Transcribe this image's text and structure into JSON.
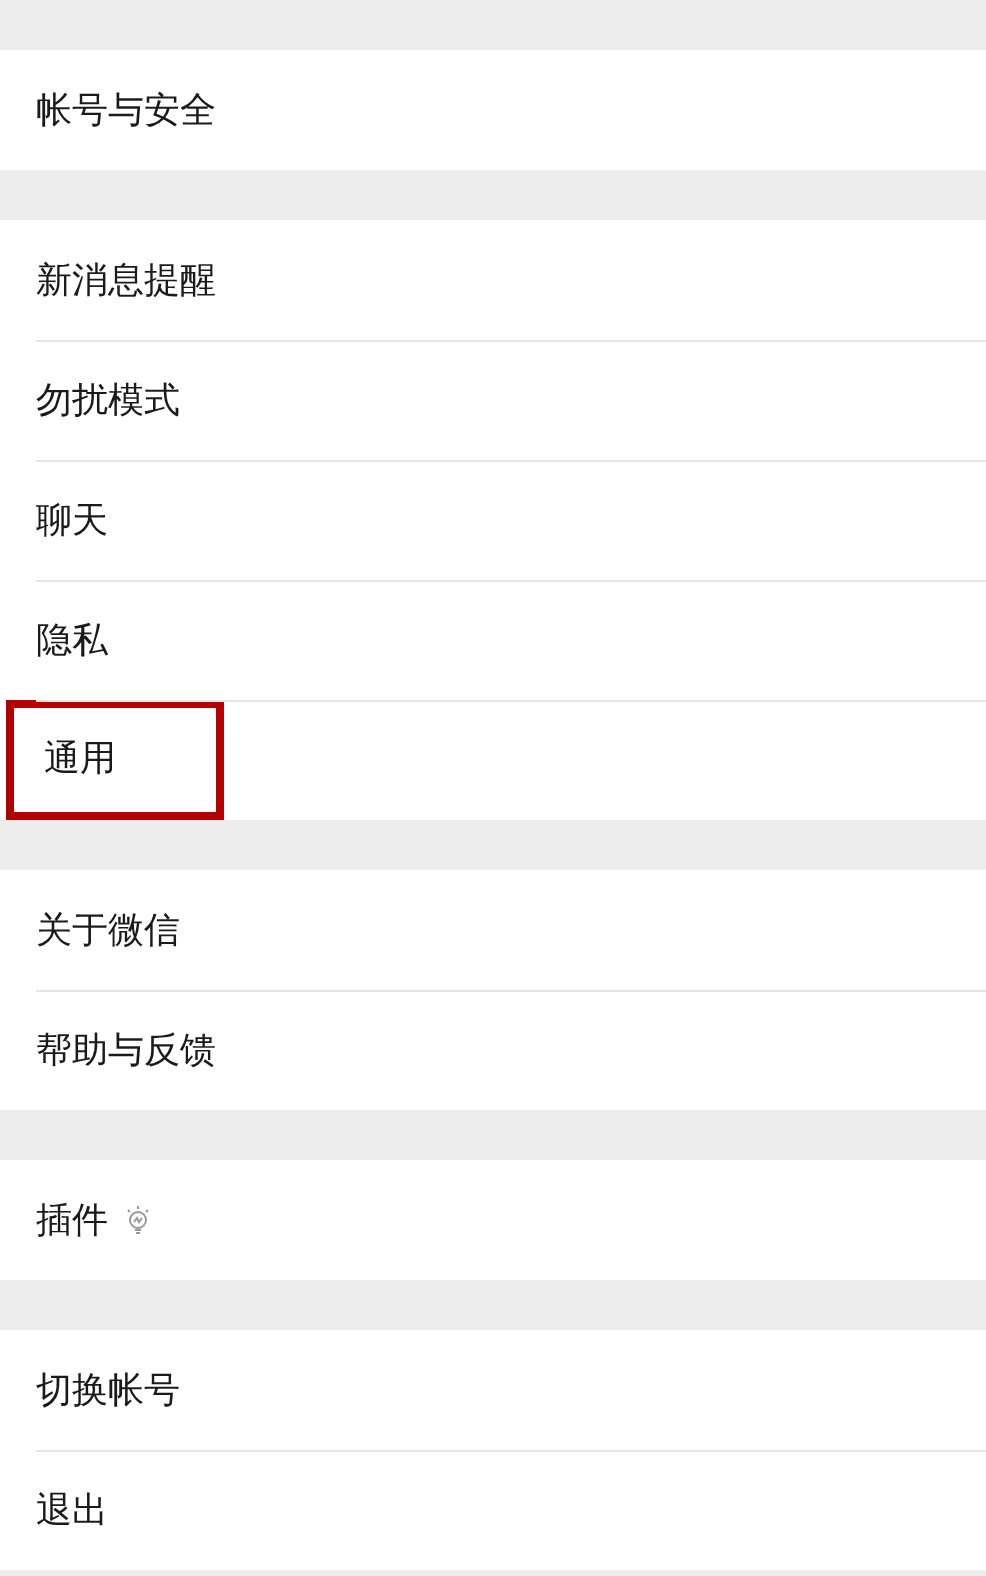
{
  "groups": [
    {
      "items": [
        {
          "label": "帐号与安全",
          "highlighted": false,
          "icon": false
        }
      ]
    },
    {
      "items": [
        {
          "label": "新消息提醒",
          "highlighted": false,
          "icon": false
        },
        {
          "label": "勿扰模式",
          "highlighted": false,
          "icon": false
        },
        {
          "label": "聊天",
          "highlighted": false,
          "icon": false
        },
        {
          "label": "隐私",
          "highlighted": false,
          "icon": false
        },
        {
          "label": "通用",
          "highlighted": true,
          "icon": false
        }
      ]
    },
    {
      "items": [
        {
          "label": "关于微信",
          "highlighted": false,
          "icon": false
        },
        {
          "label": "帮助与反馈",
          "highlighted": false,
          "icon": false
        }
      ]
    },
    {
      "items": [
        {
          "label": "插件",
          "highlighted": false,
          "icon": true
        }
      ]
    },
    {
      "items": [
        {
          "label": "切换帐号",
          "highlighted": false,
          "icon": false
        },
        {
          "label": "退出",
          "highlighted": false,
          "icon": false
        }
      ]
    }
  ]
}
